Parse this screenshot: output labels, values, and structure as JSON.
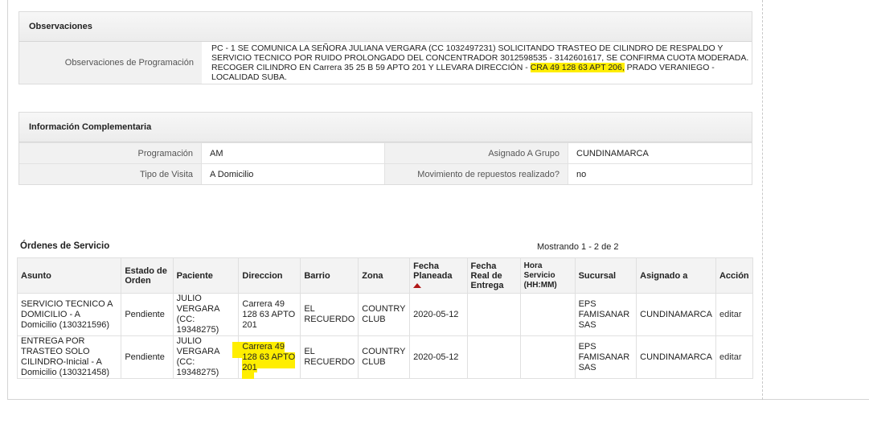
{
  "observaciones": {
    "title": "Observaciones",
    "label": "Observaciones de Programación",
    "text_before": "PC - 1 SE COMUNICA LA SEÑORA JULIANA VERGARA (CC 1032497231) SOLICITANDO TRASTEO DE CILINDRO DE RESPALDO Y SERVICIO TECNICO POR RUIDO PROLONGADO DEL CONCENTRADOR 3012598535 - 3142601617, SE CONFIRMA CUOTA MODERADA. RECOGER CILINDRO EN Carrera 35 25 B 59 APTO 201 Y LLEVARA DIRECCIÓN - ",
    "text_highlight": "CRA 49 128 63 APT 206,",
    "text_after": " PRADO VERANIEGO - LOCALIDAD SUBA."
  },
  "info": {
    "title": "Información Complementaria",
    "rows": [
      {
        "label1": "Programación",
        "value1": "AM",
        "label2": "Asignado A Grupo",
        "value2": "CUNDINAMARCA"
      },
      {
        "label1": "Tipo de Visita",
        "value1": "A Domicilio",
        "label2": "Movimiento de repuestos realizado?",
        "value2": "no"
      }
    ]
  },
  "orders": {
    "title": "Órdenes de Servicio",
    "count": "Mostrando 1 - 2 de 2",
    "headers": {
      "asunto": "Asunto",
      "estado": "Estado de Orden",
      "paciente": "Paciente",
      "direccion": "Direccion",
      "barrio": "Barrio",
      "zona": "Zona",
      "fecha_planeada": "Fecha Planeada",
      "fecha_real": "Fecha Real de Entrega",
      "hora": "Hora Servicio (HH:MM)",
      "sucursal": "Sucursal",
      "asignado": "Asignado a",
      "accion": "Acción"
    },
    "rows": [
      {
        "asunto": "SERVICIO TECNICO A DOMICILIO - A Domicilio (130321596)",
        "estado": "Pendiente",
        "paciente": "JULIO VERGARA (CC: 19348275)",
        "direccion": "Carrera 49 128 63 APTO 201",
        "barrio": "EL RECUERDO",
        "zona": "COUNTRY CLUB",
        "fecha_planeada": "2020-05-12",
        "fecha_real": "",
        "hora": "",
        "sucursal": "EPS FAMISANAR SAS",
        "asignado": "CUNDINAMARCA",
        "accion": "editar"
      },
      {
        "asunto": "ENTREGA POR TRASTEO SOLO CILINDRO-Inicial - A Domicilio (130321458)",
        "estado": "Pendiente",
        "paciente": "JULIO VERGARA (CC: 19348275)",
        "direccion": "Carrera 49 128 63 APTO 201",
        "barrio": "EL RECUERDO",
        "zona": "COUNTRY CLUB",
        "fecha_planeada": "2020-05-12",
        "fecha_real": "",
        "hora": "",
        "sucursal": "EPS FAMISANAR SAS",
        "asignado": "CUNDINAMARCA",
        "accion": "editar"
      }
    ]
  },
  "colors": {
    "highlight": "#ffee00",
    "sort_arrow": "#b01818"
  }
}
